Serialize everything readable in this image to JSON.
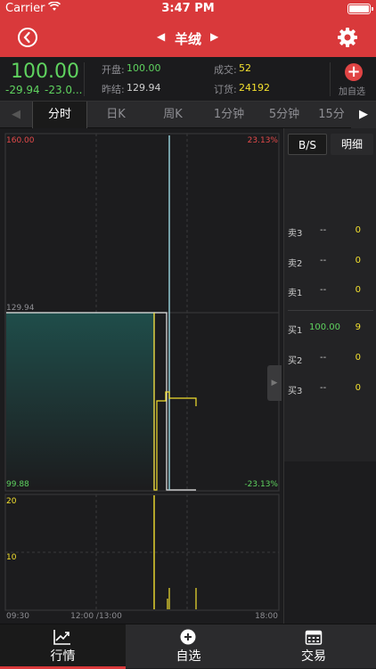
{
  "status": {
    "carrier": "Carrier",
    "time": "3:47 PM"
  },
  "nav": {
    "title": "羊绒"
  },
  "quote": {
    "last_price": "100.00",
    "change": "-29.94",
    "change_pct": "-23.0...",
    "open_label": "开盘:",
    "open_value": "100.00",
    "prev_close_label": "昨结:",
    "prev_close_value": "129.94",
    "volume_label": "成交:",
    "volume_value": "52",
    "order_label": "订货:",
    "order_value": "24192",
    "add_label": "加自选"
  },
  "tabs": [
    "分时",
    "日K",
    "周K",
    "1分钟",
    "5分钟",
    "15分"
  ],
  "chart_data": {
    "type": "line",
    "price_axis": {
      "top": "160.00",
      "mid": "129.94",
      "bottom": "99.88"
    },
    "pct_axis": {
      "top": "23.13%",
      "bottom": "-23.13%"
    },
    "volume_axis": {
      "top": "20",
      "mid": "10"
    },
    "x_labels": [
      "09:30",
      "12:00 /13:00",
      "18:00"
    ],
    "ylim": [
      99.88,
      160.0
    ],
    "volume_ylim": [
      0,
      20
    ]
  },
  "book": {
    "tab_bs": "B/S",
    "tab_detail": "明细",
    "asks": [
      {
        "label": "卖3",
        "price": "--",
        "qty": "0"
      },
      {
        "label": "卖2",
        "price": "--",
        "qty": "0"
      },
      {
        "label": "卖1",
        "price": "--",
        "qty": "0"
      }
    ],
    "bids": [
      {
        "label": "买1",
        "price": "100.00",
        "qty": "9"
      },
      {
        "label": "买2",
        "price": "--",
        "qty": "0"
      },
      {
        "label": "买3",
        "price": "--",
        "qty": "0"
      }
    ]
  },
  "tabbar": {
    "market": "行情",
    "watchlist": "自选",
    "trade": "交易"
  },
  "colors": {
    "brand": "#d9393b",
    "up": "#e34a4a",
    "down": "#5fd35f",
    "yellow": "#f3e02f"
  }
}
